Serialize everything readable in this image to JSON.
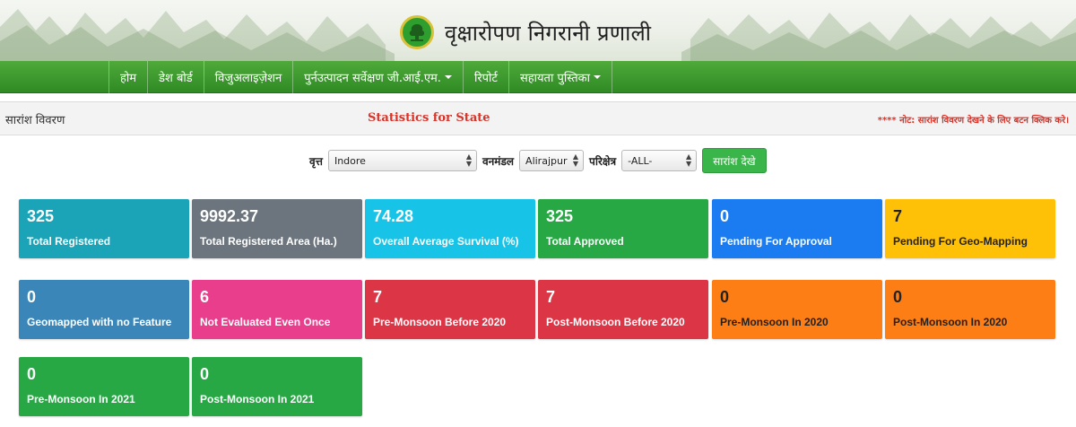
{
  "header": {
    "title": "वृक्षारोपण निगरानी प्रणाली",
    "logo_icon": "tree-logo-icon"
  },
  "nav": {
    "items": [
      {
        "label": "होम",
        "dropdown": false
      },
      {
        "label": "डेश बोर्ड",
        "dropdown": false
      },
      {
        "label": "विजुअलाइज़ेशन",
        "dropdown": false
      },
      {
        "label": "पुर्नउत्पादन सर्वेक्षण जी.आई.एम.",
        "dropdown": true
      },
      {
        "label": "रिपोर्ट",
        "dropdown": false
      },
      {
        "label": "सहायता पुस्तिका",
        "dropdown": true
      }
    ]
  },
  "summary": {
    "title": "सारांश विवरण",
    "stats_title": "Statistics for State",
    "note": "**** नोट: सारांश विवरण देखने के लिए बटन क्लिक करे।"
  },
  "filters": {
    "circle_label": "वृत्त",
    "circle_value": "Indore",
    "division_label": "वनमंडल",
    "division_value": "Alirajpur",
    "range_label": "परिक्षेत्र",
    "range_value": "-ALL-",
    "button_label": "सारांश देखे"
  },
  "cards": [
    {
      "value": "325",
      "label": "Total Registered",
      "color": "#1ba3b8"
    },
    {
      "value": "9992.37",
      "label": "Total Registered Area (Ha.)",
      "color": "#6c757d"
    },
    {
      "value": "74.28",
      "label": "Overall Average Survival (%)",
      "color": "#17c3e6"
    },
    {
      "value": "325",
      "label": "Total Approved",
      "color": "#28a745"
    },
    {
      "value": "0",
      "label": "Pending For Approval",
      "color": "#1a7cf0"
    },
    {
      "value": "7",
      "label": "Pending For Geo-Mapping",
      "color": "#ffc107"
    },
    {
      "value": "0",
      "label": "Geomapped with no Feature",
      "color": "#3b86b8"
    },
    {
      "value": "6",
      "label": "Not Evaluated Even Once",
      "color": "#e83e8c"
    },
    {
      "value": "7",
      "label": "Pre-Monsoon Before 2020",
      "color": "#dc3545"
    },
    {
      "value": "7",
      "label": "Post-Monsoon Before 2020",
      "color": "#dc3545"
    },
    {
      "value": "0",
      "label": "Pre-Monsoon In 2020",
      "color": "#fd7e14"
    },
    {
      "value": "0",
      "label": "Post-Monsoon In 2020",
      "color": "#fd7e14"
    },
    {
      "value": "0",
      "label": "Pre-Monsoon In 2021",
      "color": "#28a745"
    },
    {
      "value": "0",
      "label": "Post-Monsoon In 2021",
      "color": "#28a745"
    }
  ]
}
